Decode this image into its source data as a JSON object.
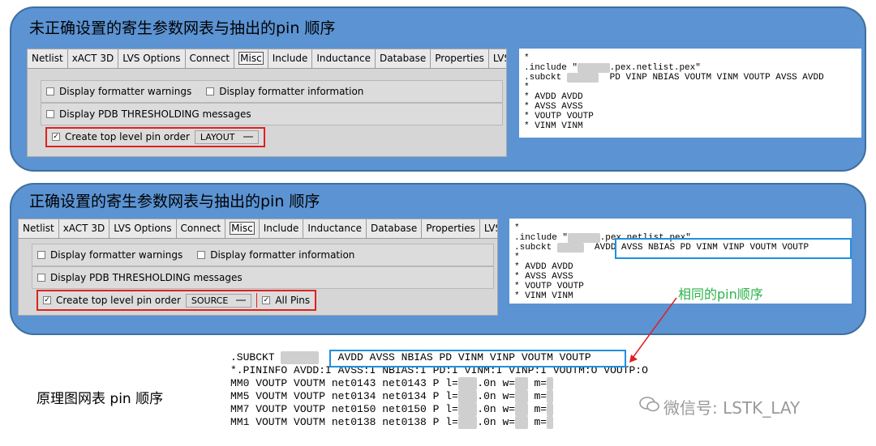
{
  "section1": {
    "title": "未正确设置的寄生参数网表与抽出的pin 顺序",
    "gui": {
      "tabs": [
        "Netlist",
        "xACT 3D",
        "LVS Options",
        "Connect",
        "Misc",
        "Include",
        "Inductance",
        "Database",
        "Properties",
        "LVS"
      ],
      "active_tab": "Misc",
      "opt_warnings": "Display formatter warnings",
      "opt_information": "Display formatter information",
      "opt_pdb": "Display PDB THRESHOLDING messages",
      "opt_pin_order": "Create top level pin order",
      "pin_order_value": "LAYOUT"
    },
    "netlist": {
      "line0": "*",
      "include_prefix": ".include \"",
      "include_suffix": ".pex.netlist.pex\"",
      "subckt_prefix": ".subckt",
      "subckt_pins": "PD VINP NBIAS VOUTM VINM VOUTP AVSS AVDD",
      "line3": "*",
      "line4": "* AVDD AVDD",
      "line5": "* AVSS AVSS",
      "line6": "* VOUTP VOUTP",
      "line7": "* VINM VINM"
    }
  },
  "section2": {
    "title": "正确设置的寄生参数网表与抽出的pin 顺序",
    "gui": {
      "tabs": [
        "Netlist",
        "xACT 3D",
        "LVS Options",
        "Connect",
        "Misc",
        "Include",
        "Inductance",
        "Database",
        "Properties",
        "LVS"
      ],
      "active_tab": "Misc",
      "opt_warnings": "Display formatter warnings",
      "opt_information": "Display formatter information",
      "opt_pdb": "Display PDB THRESHOLDING messages",
      "opt_pin_order": "Create top level pin order",
      "pin_order_value": "SOURCE",
      "opt_all_pins": "All Pins"
    },
    "netlist": {
      "line0": "*",
      "include_prefix": ".include \"",
      "include_suffix": ".pex.netlist.pex\"",
      "subckt_prefix": ".subckt",
      "subckt_pins": "AVDD AVSS NBIAS PD VINM VINP VOUTM VOUTP",
      "line3": "*",
      "line4": "* AVDD AVDD",
      "line5": "* AVSS AVSS",
      "line6": "* VOUTP VOUTP",
      "line7": "* VINM VINM"
    },
    "annotation": "相同的pin顺序"
  },
  "schematic": {
    "label": "原理图网表  pin 顺序",
    "subckt_prefix": ".SUBCKT",
    "subckt_pins": "AVDD AVSS NBIAS PD VINM VINP VOUTM VOUTP",
    "pininfo": "*.PININFO AVDD:I AVSS:I NBIAS:I PD:I VINM:I VINP:I VOUTM:O VOUTP:O",
    "mm0": "MM0 VOUTP VOUTM net0143 net0143 P l=",
    "mm5": "MM5 VOUTM VOUTP net0134 net0134 P l=",
    "mm7": "MM7 VOUTP VOUTP net0150 net0150 P l=",
    "mm1": "MM1 VOUTM VOUTM net0138 net0138 P l=",
    "len_suffix": ".0n w=",
    "m_suffix": "m="
  },
  "watermark": "微信号: LSTK_LAY",
  "colors": {
    "panel": "#5b93d3",
    "highlight_red": "#e02020",
    "highlight_blue": "#1e90e0",
    "annotation_green": "#2db34a"
  }
}
